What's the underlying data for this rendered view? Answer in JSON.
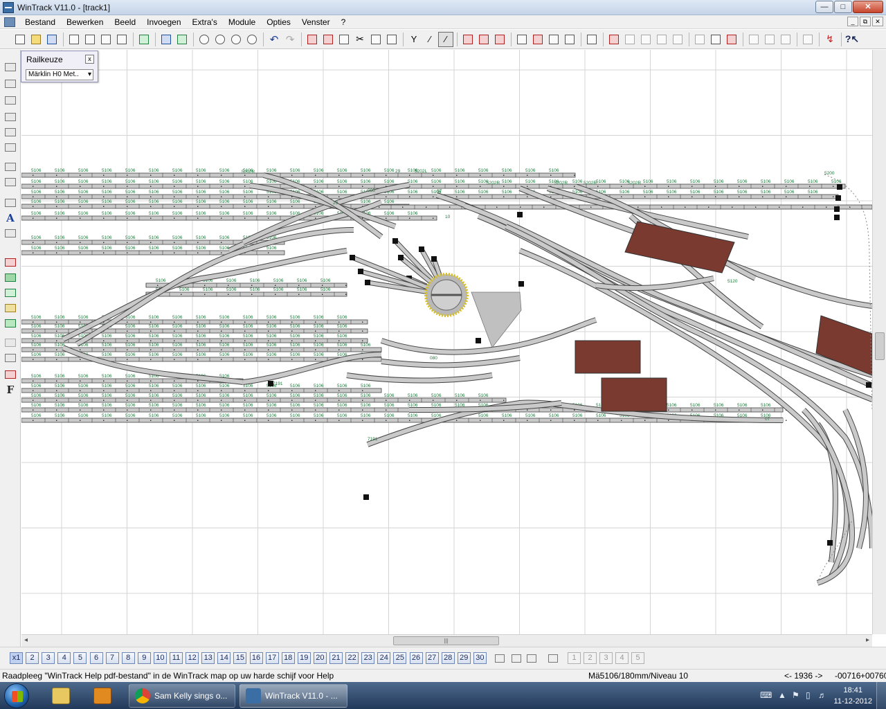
{
  "window": {
    "title": "WinTrack  V11.0 - [track1]"
  },
  "menu": [
    "Bestand",
    "Bewerken",
    "Beeld",
    "Invoegen",
    "Extra's",
    "Module",
    "Opties",
    "Venster",
    "?"
  ],
  "railpanel": {
    "title": "Railkeuze",
    "close": "x",
    "selected": "Märklin H0 Met.."
  },
  "left_toolbar": {
    "text_tool": "A",
    "font_tool": "F"
  },
  "track_labels": {
    "piece": "5106",
    "piece_short": "5108",
    "turnout_left": "5202L",
    "turnout_right": "5202R",
    "curve": "5200",
    "buffer": "7191",
    "crossing": "29",
    "special": "5120",
    "num07": "07",
    "num10": "10",
    "num080": "080"
  },
  "scrollbar": {
    "left_arrow": "◂",
    "right_arrow": "▸",
    "thumb_grip": "|||"
  },
  "module_tabs": [
    "x1",
    "2",
    "3",
    "4",
    "5",
    "6",
    "7",
    "8",
    "9",
    "10",
    "11",
    "12",
    "13",
    "14",
    "15",
    "16",
    "17",
    "18",
    "19",
    "20",
    "21",
    "22",
    "23",
    "24",
    "25",
    "26",
    "27",
    "28",
    "29",
    "30"
  ],
  "module_disabled": [
    "1",
    "2",
    "3",
    "4",
    "5"
  ],
  "status": {
    "help": "Raadpleeg \"WinTrack Help pdf-bestand\" in de WinTrack map op uw harde schijf voor Help",
    "track": "Mä5106/180mm/Niveau 10",
    "coord1": "<- 1936 ->",
    "coord2": "-00716",
    "coord3": "+00760"
  },
  "taskbar": {
    "tasks": [
      {
        "label": "Sam Kelly sings o...",
        "active": false
      },
      {
        "label": "WinTrack  V11.0 - ...",
        "active": true
      }
    ],
    "time": "18:41",
    "date": "11-12-2012"
  },
  "colors": {
    "track_fill": "#c9c9c9",
    "track_edge": "#444444",
    "label_green": "#1b7a3a",
    "building": "#7a3a30",
    "grid": "#d4d4d4",
    "turntable": "#b8b8b8",
    "turntable_ring": "#d8c020"
  },
  "icons": [
    "new-icon",
    "open-icon",
    "save-icon",
    "print-preview-icon",
    "print-icon",
    "zoom-in-icon",
    "zoom-out-icon",
    "undo-icon",
    "redo-icon",
    "cut-icon",
    "copy-icon",
    "paste-icon",
    "help-icon"
  ]
}
